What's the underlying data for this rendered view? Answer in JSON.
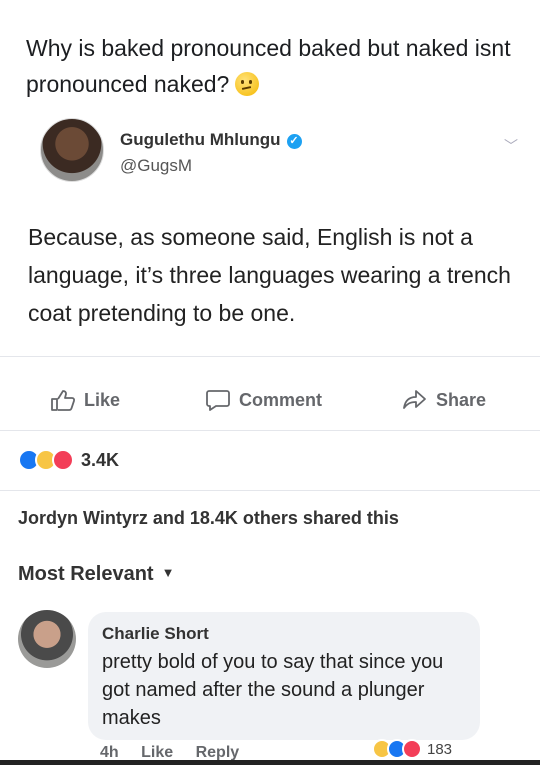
{
  "post": {
    "text": "Why is baked pronounced baked but naked isnt pronounced naked?",
    "emoji": "thinking-face"
  },
  "tweet": {
    "author_name": "Gugulethu Mhlungu",
    "handle": "@GugsM",
    "body": "Because, as someone said, English is not a language, it’s three languages wearing a trench coat pretending to be one."
  },
  "actions": {
    "like": "Like",
    "comment": "Comment",
    "share": "Share"
  },
  "reactions": {
    "count": "3.4K"
  },
  "shared_text": "Jordyn Wintyrz and 18.4K others shared this",
  "sort_label": "Most Relevant",
  "comment": {
    "author": "Charlie Short",
    "text": "pretty bold of you to say that since you got named after the sound a plunger makes",
    "time": "4h",
    "like": "Like",
    "reply": "Reply",
    "reaction_count": "183"
  },
  "colors": {
    "like_blue": "#1877f2",
    "haha_yellow": "#f7c545",
    "love_red": "#f33e58",
    "verified_blue": "#1da1f2"
  }
}
